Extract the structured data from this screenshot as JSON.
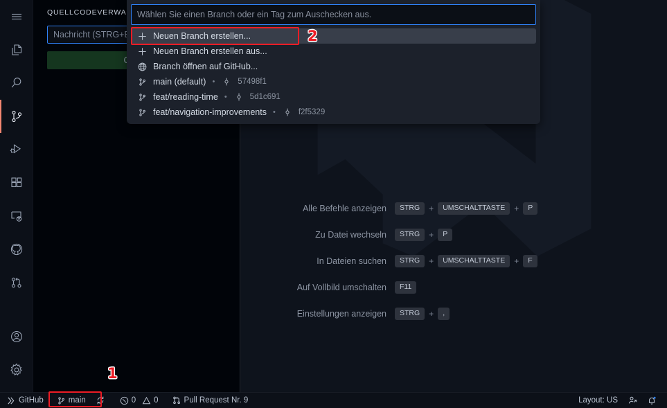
{
  "theme": {
    "editor_bg": "#0e131c",
    "sidebar_bg": "#010409",
    "activitybar_bg": "#0c1018",
    "quickpick_bg": "#1c212b",
    "selection_bg": "#383e4a",
    "focus_border": "#2f81f7",
    "active_indicator": "#f48771",
    "commit_button_bg": "#15361f",
    "annotation_color": "#ee1c25"
  },
  "activity_bar": {
    "items": [
      {
        "name": "menu",
        "label": "Menü",
        "icon": "hamburger-menu-icon",
        "active": false
      },
      {
        "name": "explorer",
        "label": "Explorer",
        "icon": "files-icon",
        "active": false
      },
      {
        "name": "search",
        "label": "Suchen",
        "icon": "search-icon",
        "active": false
      },
      {
        "name": "source-control",
        "label": "Quellcodeverwaltung",
        "icon": "source-control-icon",
        "active": true
      },
      {
        "name": "run-debug",
        "label": "Ausführen und Debuggen",
        "icon": "run-debug-icon",
        "active": false
      },
      {
        "name": "extensions",
        "label": "Erweiterungen",
        "icon": "extensions-icon",
        "active": false
      },
      {
        "name": "remote-explorer",
        "label": "Remoteexplorer",
        "icon": "remote-explorer-icon",
        "active": false
      },
      {
        "name": "github",
        "label": "GitHub",
        "icon": "github-icon",
        "active": false
      },
      {
        "name": "pull-requests",
        "label": "Pull Requests",
        "icon": "pull-request-icon",
        "active": false
      },
      {
        "name": "accounts",
        "label": "Konten",
        "icon": "account-icon",
        "active": false
      },
      {
        "name": "manage",
        "label": "Verwalten",
        "icon": "gear-icon",
        "active": false
      }
    ]
  },
  "sidebar": {
    "title": "QUELLCODEVERWALTUNG",
    "commit_message_placeholder": "Nachricht (STRG+EINGABETASTE zum Commit auf \"main\")",
    "commit_button_label": "Commit"
  },
  "quickpick": {
    "input_placeholder": "Wählen Sie einen Branch oder ein Tag zum Auschecken aus.",
    "input_value": "",
    "items": [
      {
        "icon": "plus-icon",
        "label": "Neuen Branch erstellen...",
        "selected": true,
        "hash": ""
      },
      {
        "icon": "plus-icon",
        "label": "Neuen Branch erstellen aus...",
        "selected": false,
        "hash": ""
      },
      {
        "icon": "globe-icon",
        "label": "Branch öffnen auf GitHub...",
        "selected": false,
        "hash": ""
      },
      {
        "icon": "branch-icon",
        "label": "main (default)",
        "selected": false,
        "hash": "57498f1"
      },
      {
        "icon": "branch-icon",
        "label": "feat/reading-time",
        "selected": false,
        "hash": "5d1c691"
      },
      {
        "icon": "branch-icon",
        "label": "feat/navigation-improvements",
        "selected": false,
        "hash": "f2f5329"
      }
    ]
  },
  "editor": {
    "watermark_shortcuts": [
      {
        "label": "Alle Befehle anzeigen",
        "keys": [
          "STRG",
          "UMSCHALTTASTE",
          "P"
        ]
      },
      {
        "label": "Zu Datei wechseln",
        "keys": [
          "STRG",
          "P"
        ]
      },
      {
        "label": "In Dateien suchen",
        "keys": [
          "STRG",
          "UMSCHALTTASTE",
          "F"
        ]
      },
      {
        "label": "Auf Vollbild umschalten",
        "keys": [
          "F11"
        ]
      },
      {
        "label": "Einstellungen anzeigen",
        "keys": [
          "STRG",
          ","
        ]
      }
    ]
  },
  "statusbar": {
    "left": [
      {
        "name": "remote-indicator",
        "icon": "remote-icon",
        "label": "GitHub"
      },
      {
        "name": "branch",
        "icon": "branch-icon",
        "label": "main"
      },
      {
        "name": "sync",
        "icon": "sync-icon",
        "label": ""
      },
      {
        "name": "problems",
        "icon": "error-warning-icon",
        "label": "0 0",
        "errors": "0",
        "warnings": "0"
      },
      {
        "name": "pull-request",
        "icon": "pull-request-icon",
        "label": "Pull Request Nr. 9"
      }
    ],
    "right": [
      {
        "name": "keyboard-layout",
        "icon": "",
        "label": "Layout: US"
      },
      {
        "name": "live-share",
        "icon": "live-share-icon",
        "label": ""
      },
      {
        "name": "notifications",
        "icon": "bell-dot-icon",
        "label": ""
      }
    ]
  },
  "annotations": [
    {
      "number": "1",
      "target": "statusbar-branch-main"
    },
    {
      "number": "2",
      "target": "quickpick-create-new-branch"
    }
  ]
}
